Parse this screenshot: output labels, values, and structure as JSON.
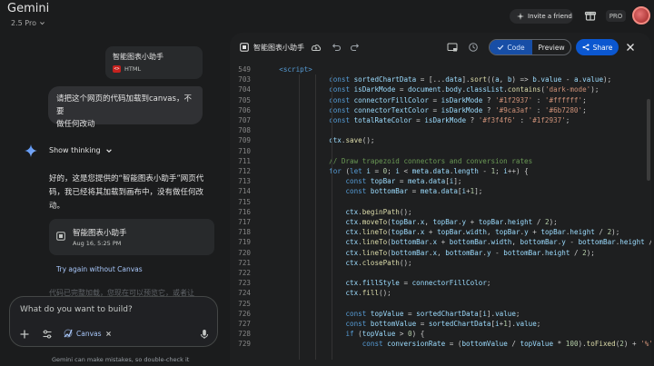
{
  "header": {
    "app_title": "Gemini",
    "model": "2.5 Pro",
    "invite_label": "Invite a friend",
    "pro_badge": "PRO"
  },
  "chat": {
    "attachment_card": {
      "title": "智能图表小助手",
      "type": "HTML"
    },
    "user_message_line1": "请把这个网页的代码加载到canvas，不要",
    "user_message_line2": "做任何改动",
    "show_thinking": "Show thinking",
    "response_line1": "好的，这是您提供的“智能图表小助手”网页代",
    "response_line2": "码，我已经将其加载到画布中，没有做任何改",
    "response_line3": "动。",
    "canvas_card": {
      "title": "智能图表小助手",
      "date": "Aug 16, 5:25 PM"
    },
    "try_again": "Try again without Canvas",
    "faded_text": "代码已完整加载，您现在可以预览它，或者让"
  },
  "composer": {
    "placeholder": "What do you want to build?",
    "canvas_chip": "Canvas",
    "disclaimer": "Gemini can make mistakes, so double-check it"
  },
  "panel": {
    "title": "智能图表小助手",
    "code_tab": "Code",
    "preview_tab": "Preview",
    "share": "Share"
  },
  "code_lines": [
    {
      "n": "549",
      "t": "    <script>"
    },
    {
      "n": "703",
      "t": "                const sortedChartData = [...data].sort((a, b) => b.value - a.value);"
    },
    {
      "n": "704",
      "t": "                const isDarkMode = document.body.classList.contains('dark-mode');"
    },
    {
      "n": "705",
      "t": "                const connectorFillColor = isDarkMode ? '#1f2937' : '#ffffff';"
    },
    {
      "n": "706",
      "t": "                const connectorTextColor = isDarkMode ? '#9ca3af' : '#6b7280';"
    },
    {
      "n": "707",
      "t": "                const totalRateColor = isDarkMode ? '#f3f4f6' : '#1f2937';"
    },
    {
      "n": "708",
      "t": ""
    },
    {
      "n": "709",
      "t": "                ctx.save();"
    },
    {
      "n": "710",
      "t": ""
    },
    {
      "n": "711",
      "t": "                // Draw trapezoid connectors and conversion rates"
    },
    {
      "n": "712",
      "t": "                for (let i = 0; i < meta.data.length - 1; i++) {"
    },
    {
      "n": "713",
      "t": "                    const topBar = meta.data[i];"
    },
    {
      "n": "714",
      "t": "                    const bottomBar = meta.data[i+1];"
    },
    {
      "n": "715",
      "t": ""
    },
    {
      "n": "716",
      "t": "                    ctx.beginPath();"
    },
    {
      "n": "717",
      "t": "                    ctx.moveTo(topBar.x, topBar.y + topBar.height / 2);"
    },
    {
      "n": "718",
      "t": "                    ctx.lineTo(topBar.x + topBar.width, topBar.y + topBar.height / 2);"
    },
    {
      "n": "719",
      "t": "                    ctx.lineTo(bottomBar.x + bottomBar.width, bottomBar.y - bottomBar.height /"
    },
    {
      "n": "720",
      "t": "                    ctx.lineTo(bottomBar.x, bottomBar.y - bottomBar.height / 2);"
    },
    {
      "n": "721",
      "t": "                    ctx.closePath();"
    },
    {
      "n": "722",
      "t": ""
    },
    {
      "n": "723",
      "t": "                    ctx.fillStyle = connectorFillColor;"
    },
    {
      "n": "724",
      "t": "                    ctx.fill();"
    },
    {
      "n": "725",
      "t": ""
    },
    {
      "n": "726",
      "t": "                    const topValue = sortedChartData[i].value;"
    },
    {
      "n": "727",
      "t": "                    const bottomValue = sortedChartData[i+1].value;"
    },
    {
      "n": "728",
      "t": "                    if (topValue > 0) {"
    },
    {
      "n": "729",
      "t": "                        const conversionRate = (bottomValue / topValue * 100).toFixed(2) + '%'"
    }
  ],
  "colors": {
    "background": "#1b1c1d",
    "panel": "#1e1f20",
    "accent_blue": "#0b57d0",
    "link_blue": "#a8c7fa"
  }
}
